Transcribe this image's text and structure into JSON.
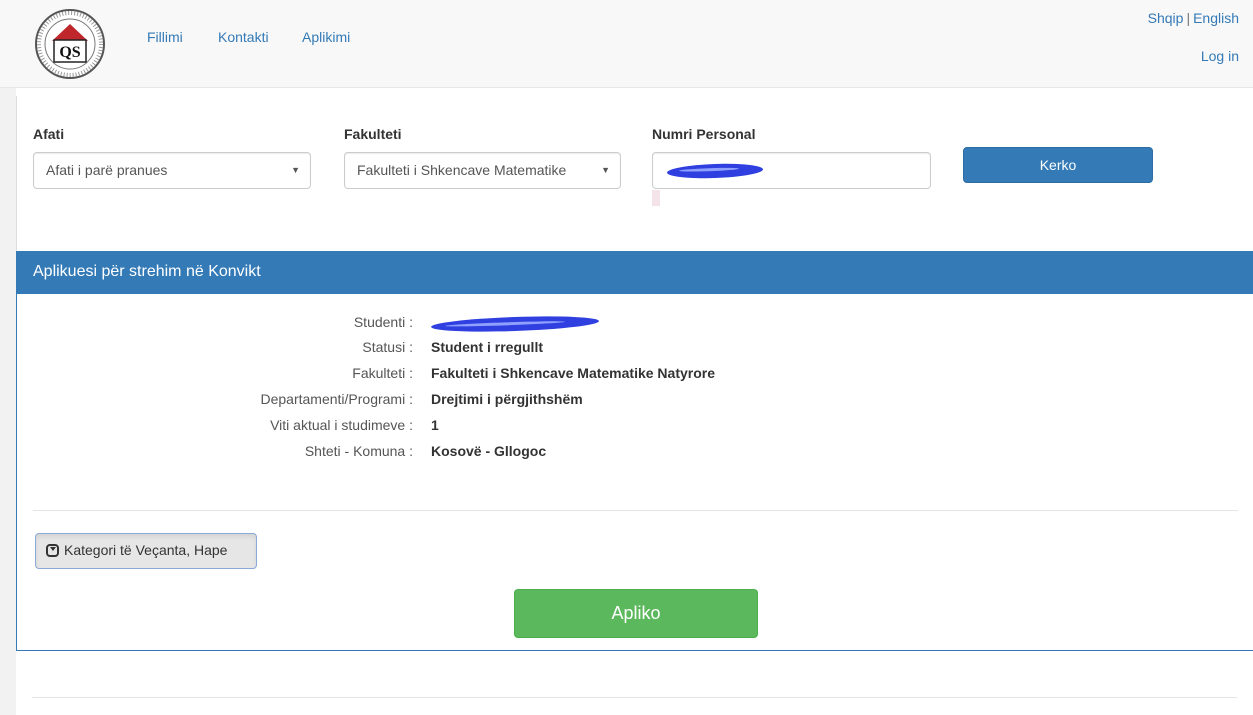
{
  "navbar": {
    "logo_text": "QS",
    "links": [
      "Fillimi",
      "Kontakti",
      "Aplikimi"
    ],
    "languages": [
      "Shqip",
      "English"
    ],
    "language_separator": "|",
    "login": "Log in"
  },
  "search": {
    "afati_label": "Afati",
    "afati_value": "Afati i parë pranues",
    "fakulteti_label": "Fakulteti",
    "fakulteti_value": "Fakulteti i Shkencave Matematike",
    "numri_label": "Numri Personal",
    "kerko_button": "Kerko"
  },
  "applicant": {
    "heading": "Aplikuesi për strehim në Konvikt",
    "rows": [
      {
        "label": "Studenti :",
        "value": ""
      },
      {
        "label": "Statusi :",
        "value": "Student i rregullt"
      },
      {
        "label": "Fakulteti :",
        "value": "Fakulteti i Shkencave Matematike Natyrore"
      },
      {
        "label": "Departamenti/Programi :",
        "value": "Drejtimi i përgjithshëm"
      },
      {
        "label": "Viti aktual i studimeve :",
        "value": "1"
      },
      {
        "label": "Shteti - Komuna :",
        "value": "Kosovë - Gllogoc"
      }
    ],
    "kategori_button": "Kategori të Veçanta, Hape",
    "apliko_button": "Apliko"
  },
  "colors": {
    "primary": "#337ab7",
    "success": "#5cb85c",
    "redaction": "#2f3fe0",
    "logo_red": "#c0272d"
  },
  "icons": {
    "kategori": "chevron-square-down-icon"
  }
}
